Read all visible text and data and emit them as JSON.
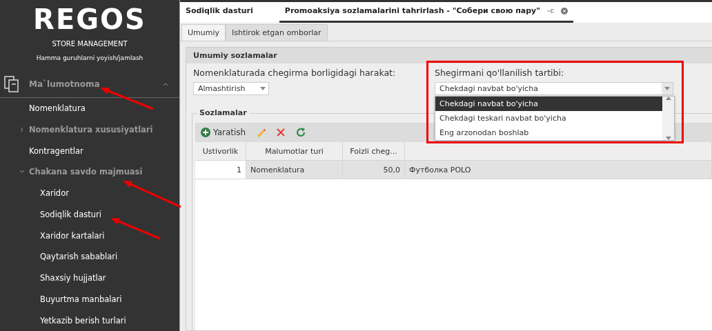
{
  "sidebar": {
    "logo": "REGOS",
    "subtitle": "STORE MANAGEMENT",
    "expand_link": "Hamma guruhlarni yoyish/jamlash",
    "section": {
      "label": "Ma`lumotnoma",
      "expanded": true,
      "children": [
        {
          "label": "Nomenklatura",
          "group": false
        },
        {
          "label": "Nomenklatura xususiyatlari",
          "group": true,
          "expanded": false
        },
        {
          "label": "Kontragentlar",
          "group": false
        },
        {
          "label": "Chakana savdo majmuasi",
          "group": true,
          "expanded": true,
          "children": [
            {
              "label": "Xaridor",
              "group": false
            },
            {
              "label": "Sodiqlik dasturi",
              "group": false
            },
            {
              "label": "Xaridor kartalari",
              "group": false
            },
            {
              "label": "Qaytarish sabablari",
              "group": false
            },
            {
              "label": "Shaxsiy hujjatlar",
              "group": false
            },
            {
              "label": "Buyurtma manbalari",
              "group": false
            },
            {
              "label": "Yetkazib berish turlari",
              "group": false
            }
          ]
        }
      ]
    }
  },
  "doc_tabs": [
    {
      "label": "Sodiqlik dasturi",
      "selected": false
    },
    {
      "label": "Promoaksiya sozlamalarini tahrirlash - \"Собери свою пару\"",
      "selected": true
    }
  ],
  "tabs": [
    {
      "label": "Umumiy",
      "selected": true
    },
    {
      "label": "Ishtirok etgan omborlar",
      "selected": false
    }
  ],
  "general": {
    "title": "Umumiy sozlamalar",
    "action": {
      "label": "Nomenklaturada chegirma borligidagi harakat:",
      "value": "Almashtirish"
    },
    "order": {
      "label": "Shegirmani qo'llanilish tartibi:",
      "value": "Chekdagi navbat bo'yicha",
      "highlighted": true,
      "options": [
        {
          "label": "Chekdagi navbat bo'yicha",
          "selected": true
        },
        {
          "label": "Chekdagi teskari navbat bo'yicha",
          "selected": false
        },
        {
          "label": "Eng arzonodan boshlab",
          "selected": false
        }
      ]
    }
  },
  "settings": {
    "title": "Sozlamalar",
    "create": "Yaratish",
    "columns": [
      "Ustivorlik",
      "Malumotlar turi",
      "Foizli cheg..."
    ],
    "rows": [
      [
        "1",
        "Nomenklatura",
        "50,0",
        "Футболка POLO"
      ]
    ]
  }
}
